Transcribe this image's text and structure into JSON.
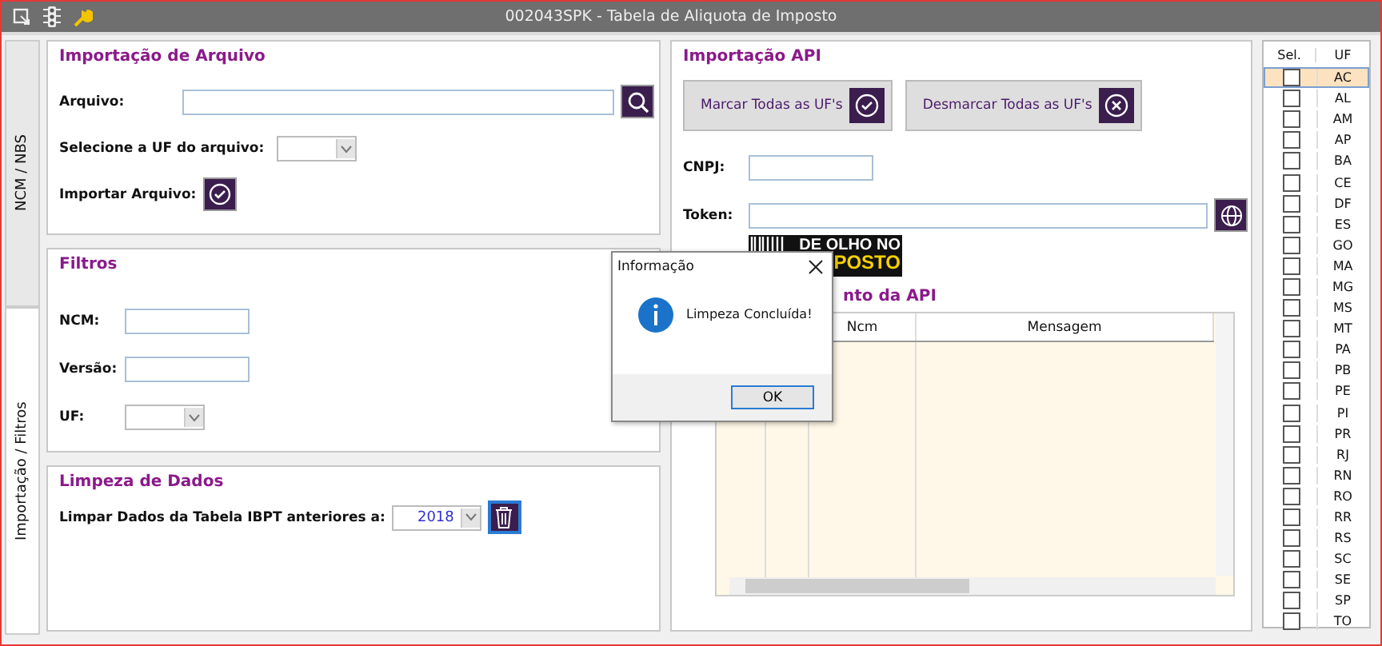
{
  "window": {
    "title": "002043SPK - Tabela de Aliquota de Imposto"
  },
  "side_tabs": [
    {
      "label": "NCM / NBS",
      "selected": false
    },
    {
      "label": "Importação / Filtros",
      "selected": true
    }
  ],
  "file_import": {
    "title": "Importação de Arquivo",
    "file_label": "Arquivo:",
    "uf_label": "Selecione a UF do arquivo:",
    "import_label": "Importar Arquivo:"
  },
  "filters": {
    "title": "Filtros",
    "fields": [
      {
        "label": "NCM:",
        "kind": "text"
      },
      {
        "label": "Versão:",
        "kind": "text"
      },
      {
        "label": "UF:",
        "kind": "select"
      }
    ]
  },
  "cleanup": {
    "title": "Limpeza de Dados",
    "label": "Limpar Dados da Tabela IBPT anteriores a:",
    "year": "2018"
  },
  "api": {
    "title": "Importação API",
    "buttons": [
      {
        "label": "Marcar Todas as UF's",
        "kind": "check"
      },
      {
        "label": "Desmarcar Todas as UF's",
        "kind": "clear"
      }
    ],
    "cnpj_label": "CNPJ:",
    "token_label": "Token:",
    "logo": [
      "DE OLHO NO",
      "POSTO"
    ],
    "result_title": "nto da API",
    "columns": [
      "Ncm",
      "Mensagem"
    ]
  },
  "uf_table": {
    "columns": [
      "Sel.",
      "UF"
    ],
    "rows": [
      {
        "uf": "AC",
        "checked": false,
        "selected": true
      },
      {
        "uf": "AL",
        "checked": false,
        "selected": false
      },
      {
        "uf": "AM",
        "checked": false,
        "selected": false
      },
      {
        "uf": "AP",
        "checked": false,
        "selected": false
      },
      {
        "uf": "BA",
        "checked": false,
        "selected": false
      },
      {
        "uf": "CE",
        "checked": false,
        "selected": false
      },
      {
        "uf": "DF",
        "checked": false,
        "selected": false
      },
      {
        "uf": "ES",
        "checked": false,
        "selected": false
      },
      {
        "uf": "GO",
        "checked": false,
        "selected": false
      },
      {
        "uf": "MA",
        "checked": false,
        "selected": false
      },
      {
        "uf": "MG",
        "checked": false,
        "selected": false
      },
      {
        "uf": "MS",
        "checked": false,
        "selected": false
      },
      {
        "uf": "MT",
        "checked": false,
        "selected": false
      },
      {
        "uf": "PA",
        "checked": false,
        "selected": false
      },
      {
        "uf": "PB",
        "checked": false,
        "selected": false
      },
      {
        "uf": "PE",
        "checked": false,
        "selected": false
      },
      {
        "uf": "PI",
        "checked": false,
        "selected": false
      },
      {
        "uf": "PR",
        "checked": false,
        "selected": false
      },
      {
        "uf": "RJ",
        "checked": false,
        "selected": false
      },
      {
        "uf": "RN",
        "checked": false,
        "selected": false
      },
      {
        "uf": "RO",
        "checked": false,
        "selected": false
      },
      {
        "uf": "RR",
        "checked": false,
        "selected": false
      },
      {
        "uf": "RS",
        "checked": false,
        "selected": false
      },
      {
        "uf": "SC",
        "checked": false,
        "selected": false
      },
      {
        "uf": "SE",
        "checked": false,
        "selected": false
      },
      {
        "uf": "SP",
        "checked": false,
        "selected": false
      },
      {
        "uf": "TO",
        "checked": false,
        "selected": false
      }
    ]
  },
  "dialog": {
    "title": "Informação",
    "message": "Limpeza Concluída!",
    "button": "OK"
  }
}
